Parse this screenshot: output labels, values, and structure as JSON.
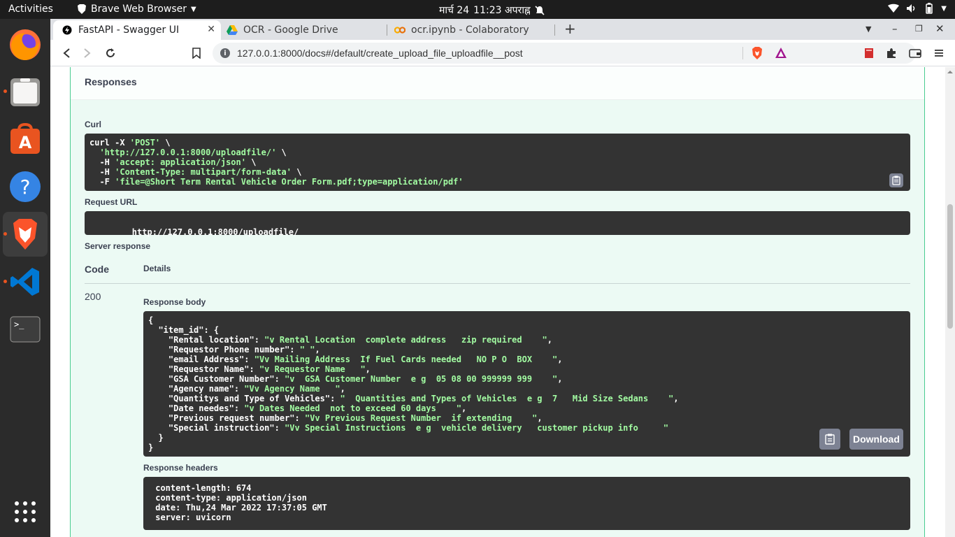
{
  "topbar": {
    "activities": "Activities",
    "app_name": "Brave Web Browser",
    "date": "मार्च 24",
    "time": "11:23 अपराह्न"
  },
  "dock": {
    "items": [
      "firefox",
      "files",
      "software",
      "help",
      "brave",
      "vscode",
      "terminal",
      "show-apps"
    ]
  },
  "tabs": [
    {
      "title": "FastAPI - Swagger UI",
      "active": true
    },
    {
      "title": "OCR - Google Drive",
      "active": false
    },
    {
      "title": "ocr.ipynb - Colaboratory",
      "active": false
    }
  ],
  "omnibox": {
    "url": "127.0.0.1:8000/docs#/default/create_upload_file_uploadfile__post"
  },
  "responses": {
    "title": "Responses",
    "curl_label": "Curl",
    "curl_lines": [
      {
        "plain": "curl -X ",
        "str": "'POST'",
        "tail": " \\"
      },
      {
        "plain": "  ",
        "str": "'http://127.0.0.1:8000/uploadfile/'",
        "tail": " \\"
      },
      {
        "plain": "  -H ",
        "str": "'accept: application/json'",
        "tail": " \\"
      },
      {
        "plain": "  -H ",
        "str": "'Content-Type: multipart/form-data'",
        "tail": " \\"
      },
      {
        "plain": "  -F ",
        "str": "'file=@Short Term Rental Vehicle Order Form.pdf;type=application/pdf'",
        "tail": ""
      }
    ],
    "request_url_label": "Request URL",
    "request_url": "http://127.0.0.1:8000/uploadfile/",
    "server_response_label": "Server response",
    "code_header": "Code",
    "details_header": "Details",
    "status_code": "200",
    "response_body_label": "Response body",
    "response_body_lines": [
      {
        "plain": "{",
        "str": "",
        "tail": ""
      },
      {
        "plain": "  \"item_id\": {",
        "str": "",
        "tail": ""
      },
      {
        "plain": "    \"Rental location\": ",
        "str": "\"v Rental Location  complete address   zip required    \"",
        "tail": ","
      },
      {
        "plain": "    \"Requestor Phone number\": ",
        "str": "\" \"",
        "tail": ","
      },
      {
        "plain": "    \"email Address\": ",
        "str": "\"Vv Mailing Address  If Fuel Cards needed   NO P O  BOX    \"",
        "tail": ","
      },
      {
        "plain": "    \"Requestor Name\": ",
        "str": "\"v Requestor Name   \"",
        "tail": ","
      },
      {
        "plain": "    \"GSA Customer Number\": ",
        "str": "\"v  GSA Customer Number  e g  05 08 00 999999 999    \"",
        "tail": ","
      },
      {
        "plain": "    \"Agency name\": ",
        "str": "\"Vv Agency Name   \"",
        "tail": ","
      },
      {
        "plain": "    \"Quantitys and Type of Vehicles\": ",
        "str": "\"  Quantities and Types of Vehicles  e g  7   Mid Size Sedans    \"",
        "tail": ","
      },
      {
        "plain": "    \"Date needes\": ",
        "str": "\"v Dates Needed  not to exceed 60 days    \"",
        "tail": ","
      },
      {
        "plain": "    \"Previous request number\": ",
        "str": "\"Vv Previous Request Number  if extending    \"",
        "tail": ","
      },
      {
        "plain": "    \"Special instruction\": ",
        "str": "\"Vv Special Instructions  e g  vehicle delivery   customer pickup info     \"",
        "tail": ""
      },
      {
        "plain": "  }",
        "str": "",
        "tail": ""
      },
      {
        "plain": "}",
        "str": "",
        "tail": ""
      }
    ],
    "download_label": "Download",
    "response_headers_label": "Response headers",
    "response_headers_lines": [
      " content-length: 674 ",
      " content-type: application/json ",
      " date: Thu,24 Mar 2022 17:37:05 GMT ",
      " server: uvicorn "
    ]
  }
}
